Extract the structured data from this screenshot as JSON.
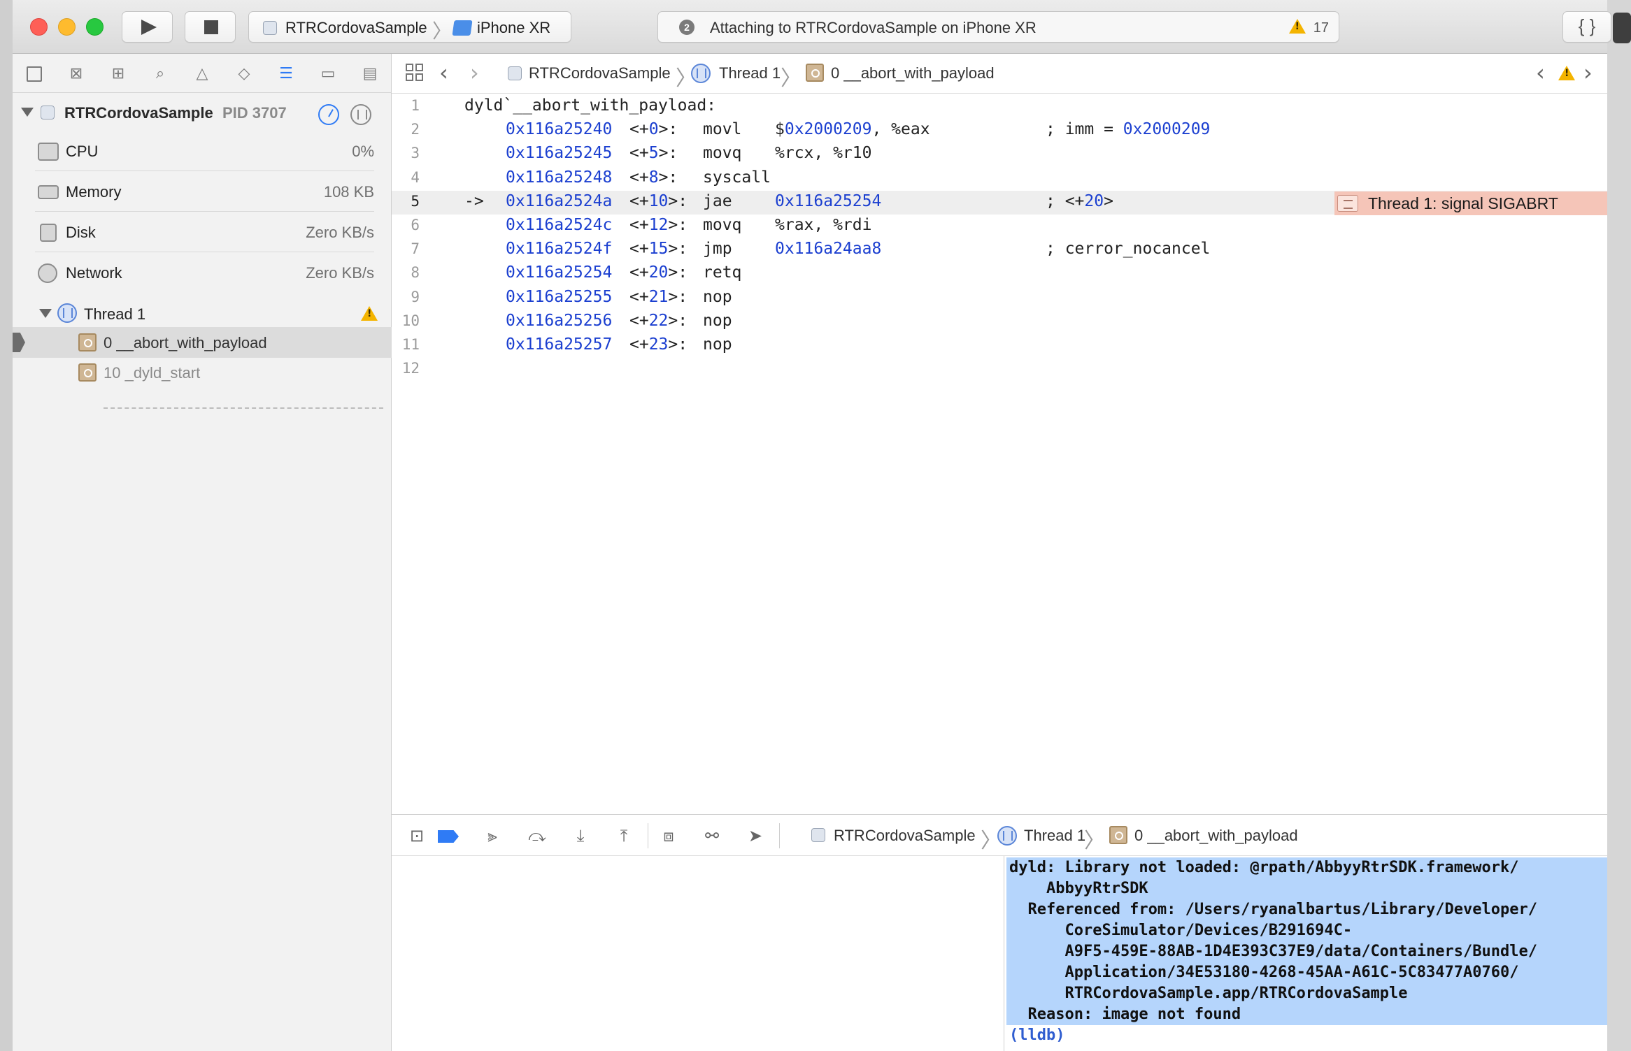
{
  "toolbar": {
    "scheme": "RTRCordovaSample",
    "destination": "iPhone XR",
    "activity_count": "2",
    "activity_status": "Attaching to RTRCordovaSample on iPhone XR",
    "warning_count": "17",
    "code_review_label": "{ }"
  },
  "navigator": {
    "process_name": "RTRCordovaSample",
    "process_pid": "PID 3707",
    "gauges": [
      {
        "label": "CPU",
        "value": "0%"
      },
      {
        "label": "Memory",
        "value": "108 KB"
      },
      {
        "label": "Disk",
        "value": "Zero KB/s"
      },
      {
        "label": "Network",
        "value": "Zero KB/s"
      }
    ],
    "thread": "Thread 1",
    "frames": [
      {
        "label": "0 __abort_with_payload"
      },
      {
        "label": "10 _dyld_start"
      }
    ]
  },
  "jumpbar": {
    "project": "RTRCordovaSample",
    "thread": "Thread 1",
    "frame": "0 __abort_with_payload"
  },
  "editor": {
    "header": "dyld`__abort_with_payload:",
    "lines": [
      {
        "num": "1"
      },
      {
        "num": "2",
        "addr": "0x116a25240",
        "off_pre": "<+",
        "off_num": "0",
        "off_post": ">:",
        "mnem": "movl",
        "ops_pre": "$",
        "ops_num": "0x2000209",
        "ops_post": ", %eax",
        "cmt_pre": "; imm = ",
        "cmt_num": "0x2000209",
        "cmt_post": ""
      },
      {
        "num": "3",
        "addr": "0x116a25245",
        "off_pre": "<+",
        "off_num": "5",
        "off_post": ">:",
        "mnem": "movq",
        "ops_pre": "%rcx, %r10",
        "ops_num": "",
        "ops_post": ""
      },
      {
        "num": "4",
        "addr": "0x116a25248",
        "off_pre": "<+",
        "off_num": "8",
        "off_post": ">:",
        "mnem": "syscall"
      },
      {
        "num": "5",
        "arrow": "->",
        "addr": "0x116a2524a",
        "off_pre": "<+",
        "off_num": "10",
        "off_post": ">:",
        "mnem": "jae",
        "ops_num": "0x116a25254",
        "cmt_pre": "; <+",
        "cmt_num": "20",
        "cmt_post": ">"
      },
      {
        "num": "6",
        "addr": "0x116a2524c",
        "off_pre": "<+",
        "off_num": "12",
        "off_post": ">:",
        "mnem": "movq",
        "ops_pre": "%rax, %rdi"
      },
      {
        "num": "7",
        "addr": "0x116a2524f",
        "off_pre": "<+",
        "off_num": "15",
        "off_post": ">:",
        "mnem": "jmp",
        "ops_num": "0x116a24aa8",
        "cmt_pre": "; cerror_nocancel"
      },
      {
        "num": "8",
        "addr": "0x116a25254",
        "off_pre": "<+",
        "off_num": "20",
        "off_post": ">:",
        "mnem": "retq"
      },
      {
        "num": "9",
        "addr": "0x116a25255",
        "off_pre": "<+",
        "off_num": "21",
        "off_post": ">:",
        "mnem": "nop"
      },
      {
        "num": "10",
        "addr": "0x116a25256",
        "off_pre": "<+",
        "off_num": "22",
        "off_post": ">:",
        "mnem": "nop"
      },
      {
        "num": "11",
        "addr": "0x116a25257",
        "off_pre": "<+",
        "off_num": "23",
        "off_post": ">:",
        "mnem": "nop"
      },
      {
        "num": "12"
      }
    ],
    "annotation": "Thread 1: signal SIGABRT"
  },
  "debugbar": {
    "project": "RTRCordovaSample",
    "thread": "Thread 1",
    "frame": "0 __abort_with_payload"
  },
  "console": {
    "lines": [
      "dyld: Library not loaded: @rpath/AbbyyRtrSDK.framework/",
      "    AbbyyRtrSDK",
      "  Referenced from: /Users/ryanalbartus/Library/Developer/",
      "      CoreSimulator/Devices/B291694C-",
      "      A9F5-459E-88AB-1D4E393C37E9/data/Containers/Bundle/",
      "      Application/34E53180-4268-45AA-A61C-5C83477A0760/",
      "      RTRCordovaSample.app/RTRCordovaSample",
      "  Reason: image not found"
    ],
    "prompt": "(lldb)"
  },
  "colors": {
    "accent": "#2f7bf5",
    "error_annotation": "#f5c5b8",
    "console_selection": "#b5d5fc",
    "address_blue": "#1b3fd0"
  }
}
